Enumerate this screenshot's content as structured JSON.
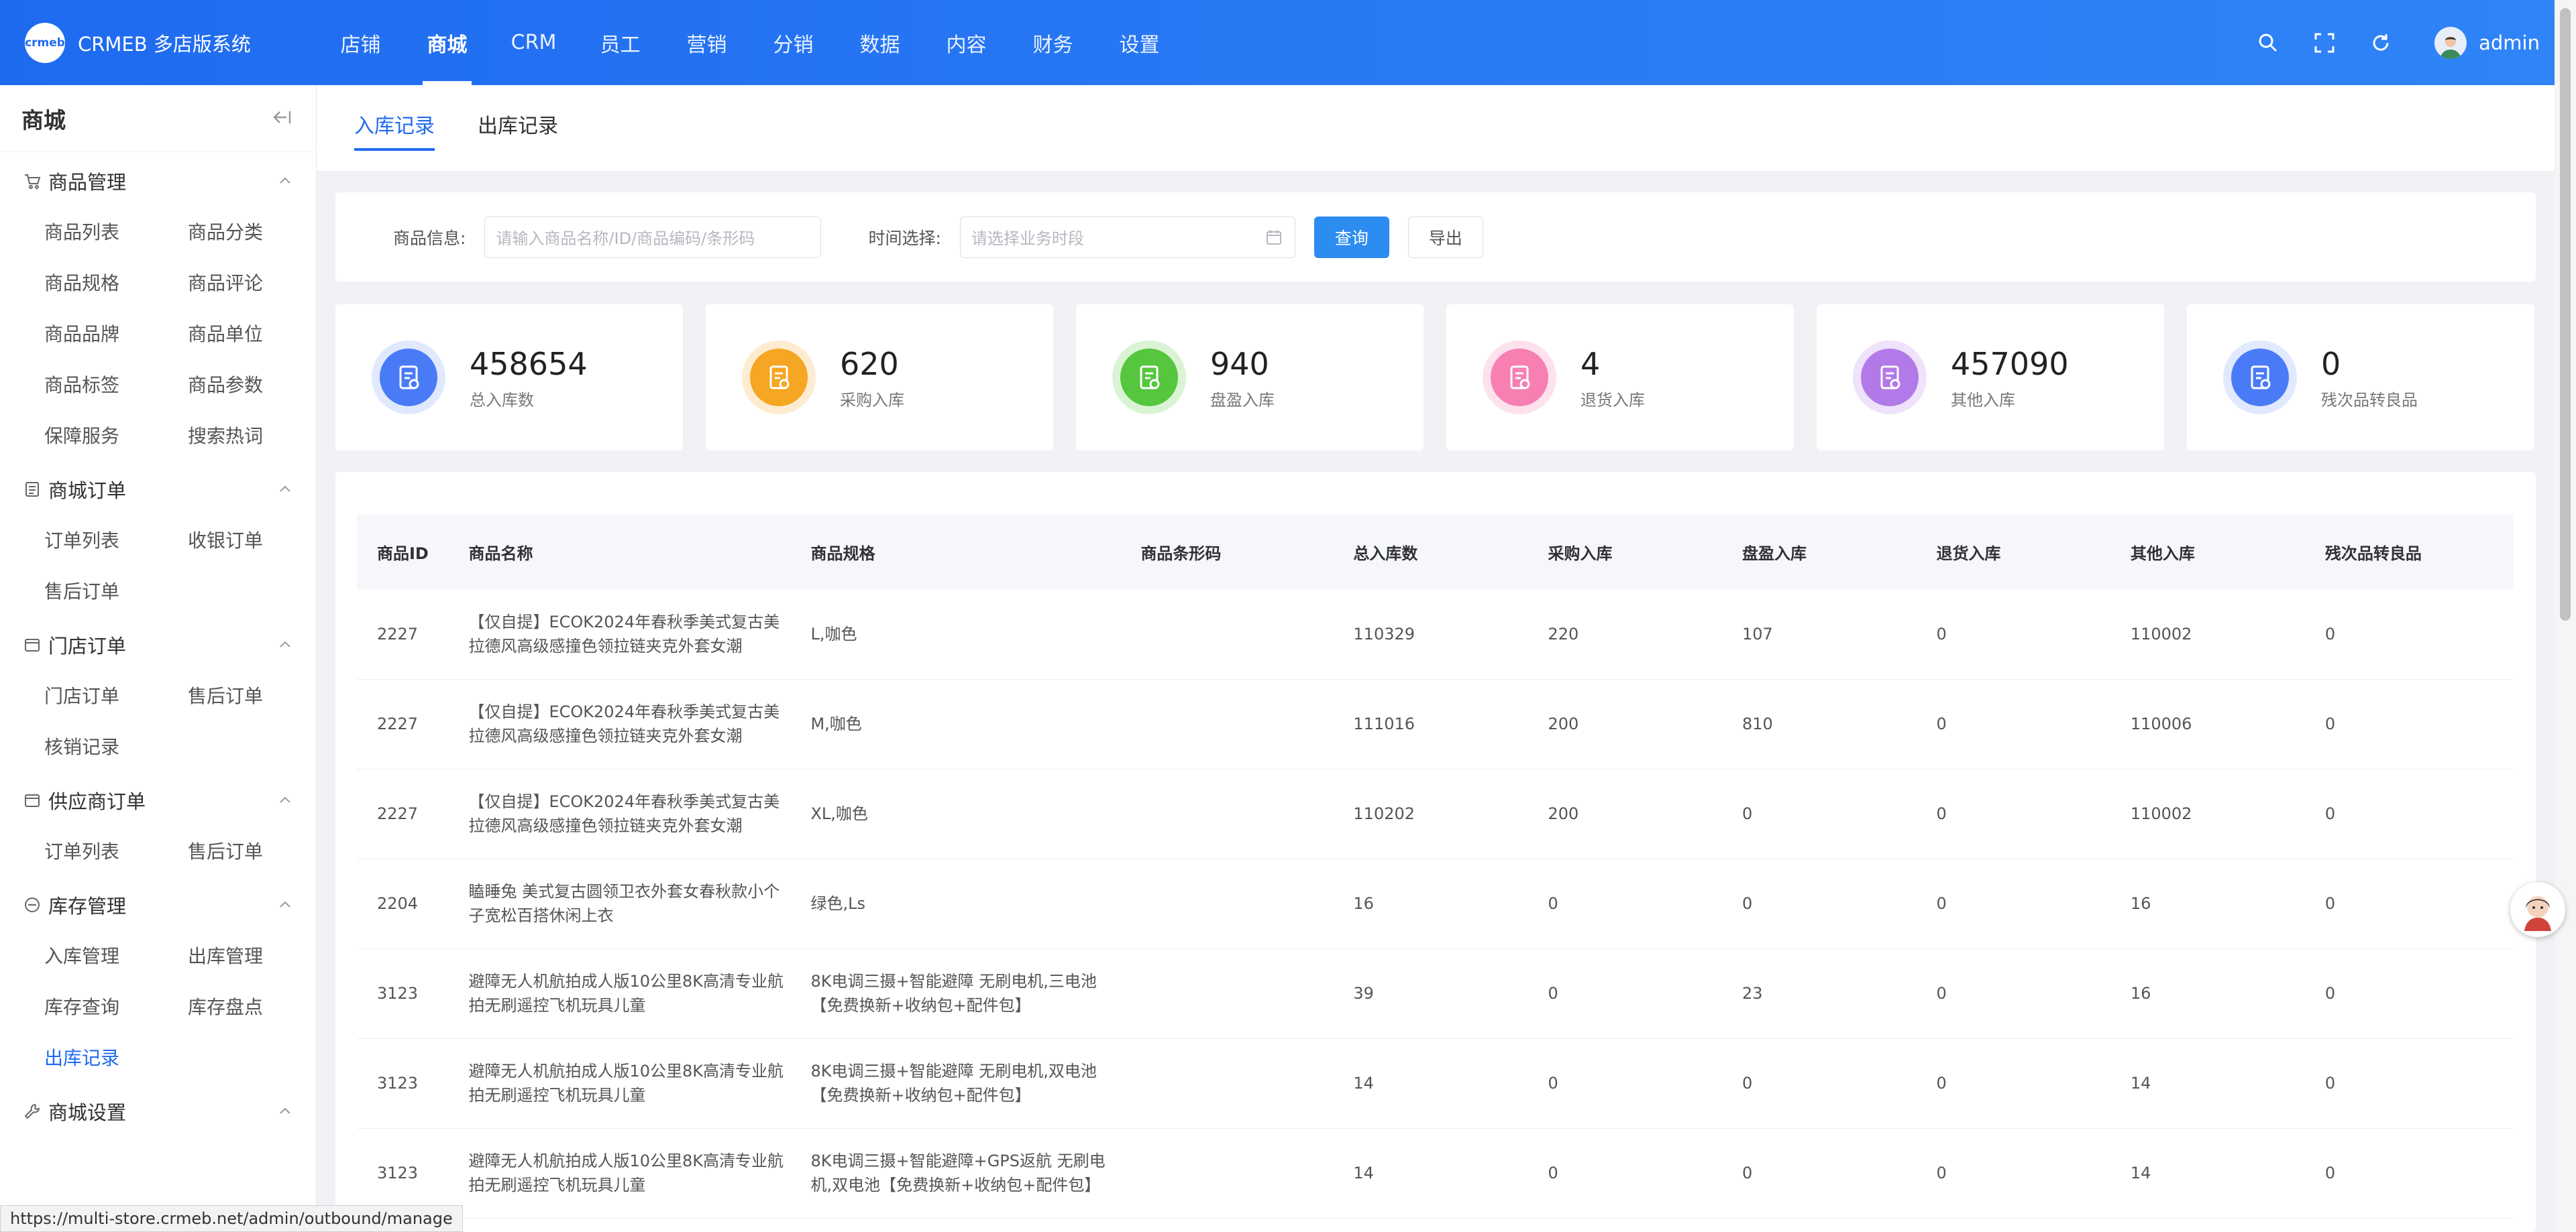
{
  "brand": {
    "logo_text": "crmeb",
    "name": "CRMEB 多店版系统"
  },
  "topnav": [
    "店铺",
    "商城",
    "CRM",
    "员工",
    "营销",
    "分销",
    "数据",
    "内容",
    "财务",
    "设置"
  ],
  "topnav_active": "商城",
  "user": {
    "name": "admin"
  },
  "sidebar": {
    "title": "商城",
    "groups": [
      {
        "title": "商品管理",
        "icon": "cart-icon",
        "items": [
          "商品列表",
          "商品分类",
          "商品规格",
          "商品评论",
          "商品品牌",
          "商品单位",
          "商品标签",
          "商品参数",
          "保障服务",
          "搜索热词"
        ]
      },
      {
        "title": "商城订单",
        "icon": "list-icon",
        "items": [
          "订单列表",
          "收银订单",
          "售后订单"
        ]
      },
      {
        "title": "门店订单",
        "icon": "folder-icon",
        "items": [
          "门店订单",
          "售后订单",
          "核销记录"
        ]
      },
      {
        "title": "供应商订单",
        "icon": "folder-icon",
        "items": [
          "订单列表",
          "售后订单"
        ]
      },
      {
        "title": "库存管理",
        "icon": "box-icon",
        "items": [
          "入库管理",
          "出库管理",
          "库存查询",
          "库存盘点",
          "出库记录"
        ]
      },
      {
        "title": "商城设置",
        "icon": "wrench-icon",
        "items": []
      }
    ],
    "active_item": "出库记录"
  },
  "tabs": [
    "入库记录",
    "出库记录"
  ],
  "active_tab": "入库记录",
  "filters": {
    "product_label": "商品信息:",
    "product_placeholder": "请输入商品名称/ID/商品编码/条形码",
    "time_label": "时间选择:",
    "time_placeholder": "请选择业务时段",
    "query_button": "查询",
    "export_button": "导出"
  },
  "stats": [
    {
      "value": "458654",
      "label": "总入库数",
      "color": "#4a7bf7",
      "ring": "#e0e9fe"
    },
    {
      "value": "620",
      "label": "采购入库",
      "color": "#f5a623",
      "ring": "#fdecd0"
    },
    {
      "value": "940",
      "label": "盘盈入库",
      "color": "#55c63d",
      "ring": "#daf3d4"
    },
    {
      "value": "4",
      "label": "退货入库",
      "color": "#f77fb1",
      "ring": "#fde2ee"
    },
    {
      "value": "457090",
      "label": "其他入库",
      "color": "#b27ae8",
      "ring": "#efe2fb"
    },
    {
      "value": "0",
      "label": "残次品转良品",
      "color": "#4a7bf7",
      "ring": "#e0e9fe"
    }
  ],
  "table": {
    "columns": [
      "商品ID",
      "商品名称",
      "商品规格",
      "商品条形码",
      "总入库数",
      "采购入库",
      "盘盈入库",
      "退货入库",
      "其他入库",
      "残次品转良品"
    ],
    "rows": [
      [
        "2227",
        "【仅自提】ECOK2024年春秋季美式复古美拉德风高级感撞色领拉链夹克外套女潮",
        "L,咖色",
        "",
        "110329",
        "220",
        "107",
        "0",
        "110002",
        "0"
      ],
      [
        "2227",
        "【仅自提】ECOK2024年春秋季美式复古美拉德风高级感撞色领拉链夹克外套女潮",
        "M,咖色",
        "",
        "111016",
        "200",
        "810",
        "0",
        "110006",
        "0"
      ],
      [
        "2227",
        "【仅自提】ECOK2024年春秋季美式复古美拉德风高级感撞色领拉链夹克外套女潮",
        "XL,咖色",
        "",
        "110202",
        "200",
        "0",
        "0",
        "110002",
        "0"
      ],
      [
        "2204",
        "瞌睡兔 美式复古圆领卫衣外套女春秋款小个子宽松百搭休闲上衣",
        "绿色,Ls",
        "",
        "16",
        "0",
        "0",
        "0",
        "16",
        "0"
      ],
      [
        "3123",
        "避障无人机航拍成人版10公里8K高清专业航拍无刷遥控飞机玩具儿童",
        "8K电调三摄+智能避障 无刷电机,三电池【免费换新+收纳包+配件包】",
        "",
        "39",
        "0",
        "23",
        "0",
        "16",
        "0"
      ],
      [
        "3123",
        "避障无人机航拍成人版10公里8K高清专业航拍无刷遥控飞机玩具儿童",
        "8K电调三摄+智能避障 无刷电机,双电池【免费换新+收纳包+配件包】",
        "",
        "14",
        "0",
        "0",
        "0",
        "14",
        "0"
      ],
      [
        "3123",
        "避障无人机航拍成人版10公里8K高清专业航拍无刷遥控飞机玩具儿童",
        "8K电调三摄+智能避障+GPS返航 无刷电机,双电池【免费换新+收纳包+配件包】",
        "",
        "14",
        "0",
        "0",
        "0",
        "14",
        "0"
      ]
    ]
  },
  "status_url": "https://multi-store.crmeb.net/admin/outbound/manage"
}
